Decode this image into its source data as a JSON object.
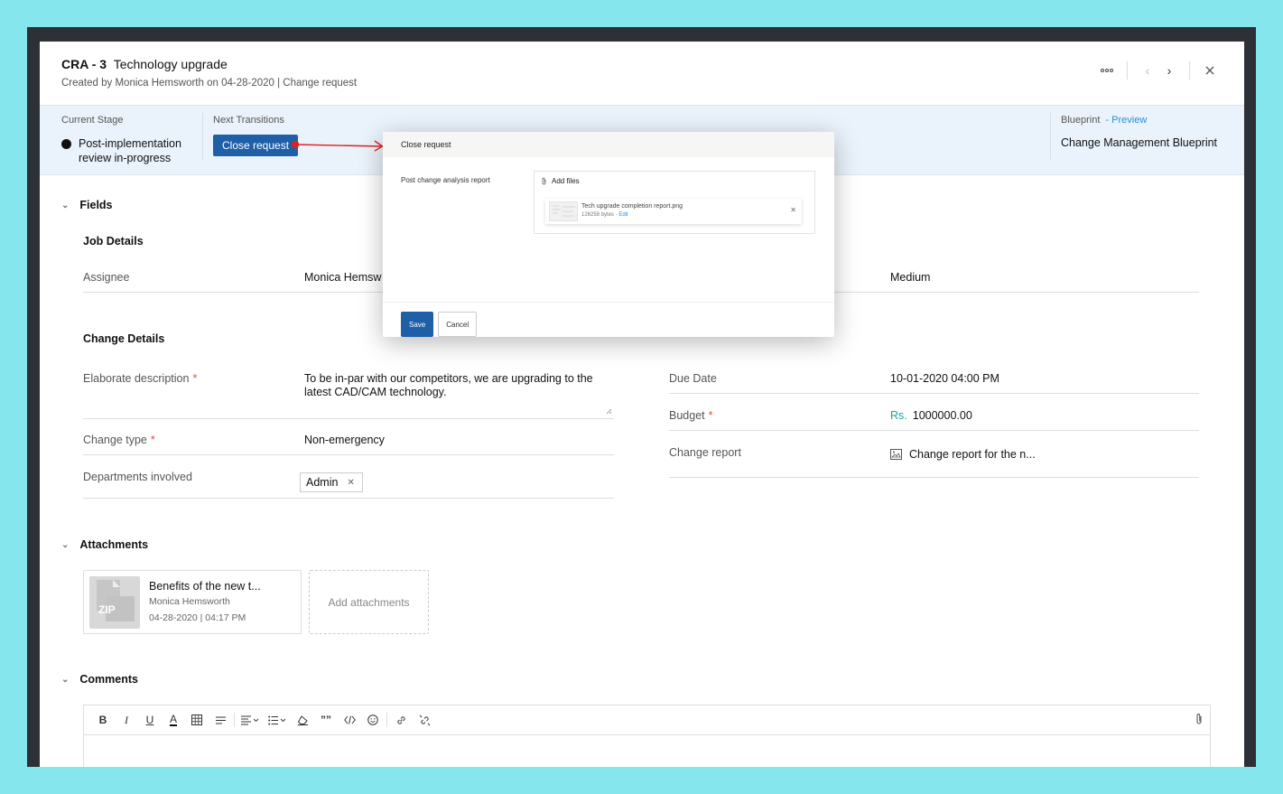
{
  "header": {
    "id": "CRA - 3",
    "title": "Technology upgrade",
    "created_by_label": "Created by",
    "created_by": "Monica Hemsworth",
    "created_on": "on 04-28-2020",
    "record_type": "| Change request"
  },
  "stage": {
    "current_label": "Current Stage",
    "current_value": "Post-implementation review in-progress",
    "next_label": "Next Transitions",
    "next_button": "Close request",
    "blueprint_label": "Blueprint",
    "blueprint_preview": "- Preview",
    "blueprint_value": "Change Management Blueprint"
  },
  "fields": {
    "section_title": "Fields",
    "job_details_title": "Job Details",
    "assignee_label": "Assignee",
    "assignee_value": "Monica Hemsw",
    "priority_value": "Medium",
    "change_details_title": "Change Details",
    "description_label": "Elaborate description",
    "description_value": "To be in-par with our competitors, we are upgrading to the latest CAD/CAM technology.",
    "change_type_label": "Change type",
    "change_type_value": "Non-emergency",
    "departments_label": "Departments involved",
    "department_chip": "Admin",
    "due_date_label": "Due Date",
    "due_date_value": "10-01-2020 04:00 PM",
    "budget_label": "Budget",
    "budget_currency": "Rs.",
    "budget_value": "1000000.00",
    "change_report_label": "Change report",
    "change_report_value": "Change report for the n...",
    "required_mark": "*"
  },
  "attachments": {
    "section_title": "Attachments",
    "file_name": "Benefits of the new t...",
    "file_type": "ZIP",
    "file_owner": "Monica Hemsworth",
    "file_date": "04-28-2020 | 04:17 PM",
    "add_label": "Add attachments"
  },
  "comments": {
    "section_title": "Comments"
  },
  "modal": {
    "title": "Close request",
    "field_label": "Post change analysis report",
    "add_files": "Add files",
    "file_name": "Tech upgrade completion report.png",
    "file_size": "126258 bytes",
    "file_edit": "- Edit",
    "save": "Save",
    "cancel": "Cancel"
  },
  "colors": {
    "primary_button": "#1e5fa8",
    "stage_bar": "#eaf2fb",
    "required": "#e34b4b",
    "arrow": "#e0211f",
    "backdrop": "#86e6ee"
  }
}
